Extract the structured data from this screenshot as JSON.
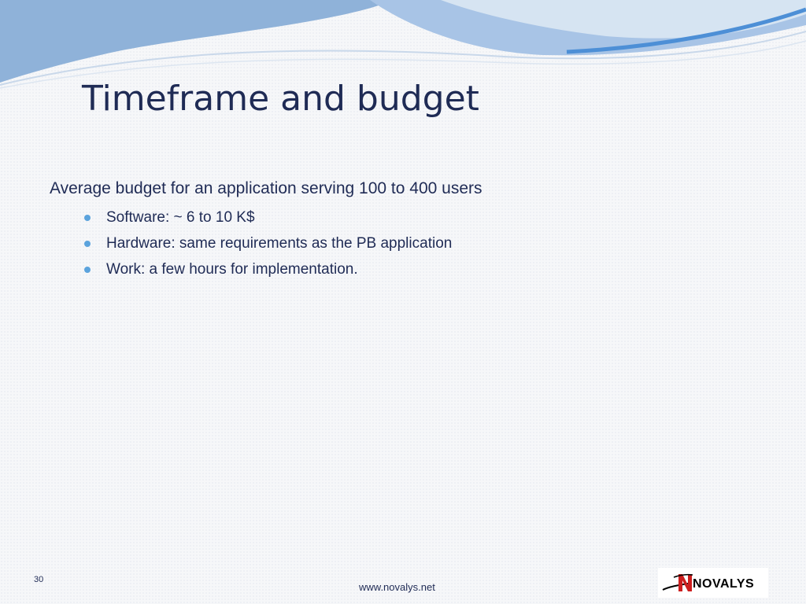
{
  "slide": {
    "title": "Timeframe and budget",
    "lead": "Average budget for an application serving 100 to 400 users",
    "bullets": [
      {
        "text": "Software: ~ 6 to 10 K$"
      },
      {
        "text": "Hardware: same requirements as the PB application"
      },
      {
        "text": "Work: a few hours for implementation."
      }
    ],
    "slide_number": "30"
  },
  "footer": {
    "url": "www.novalys.net"
  },
  "logo": {
    "wordmark": "NOVALYS",
    "colors": {
      "mark_red": "#cc1f1f",
      "text": "#000000"
    }
  },
  "theme": {
    "title_color": "#1f2b55",
    "bullet_color": "#5ba3dd",
    "wave_colors": [
      "#8fb2d9",
      "#a8c4e6",
      "#4d8fd6",
      "#d6e4f2"
    ]
  }
}
